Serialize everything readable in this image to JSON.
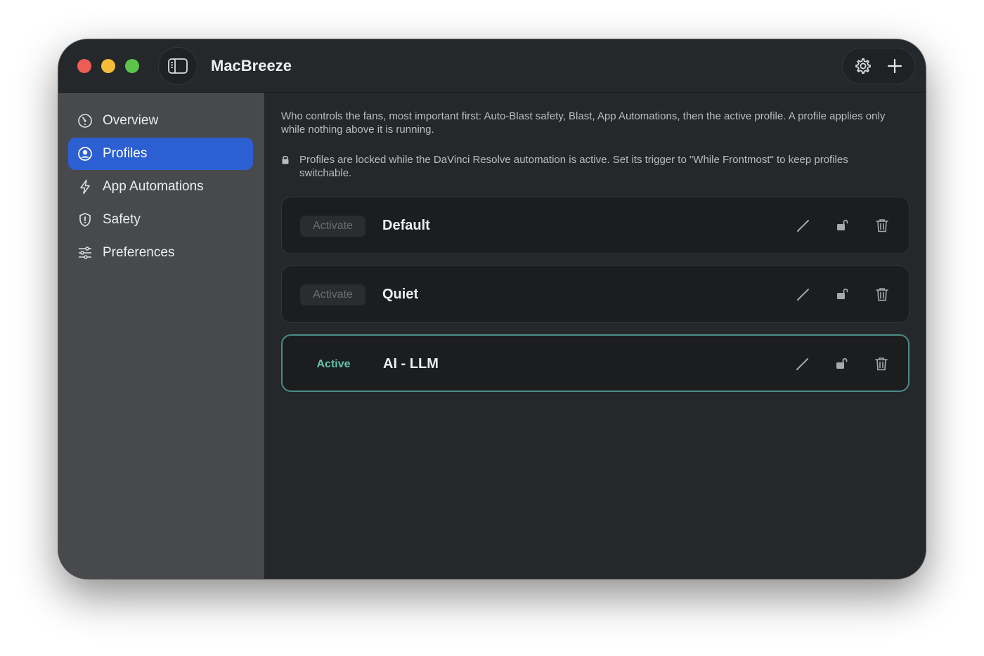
{
  "window": {
    "app_title": "MacBreeze"
  },
  "colors": {
    "accent": "#2c5fd1",
    "active_text": "#63c2b0",
    "active_border": "#4a8c86",
    "close": "#ee5c56",
    "minimize": "#f4bd39",
    "maximize": "#5cc448"
  },
  "toolbar": {
    "settings_icon": "gear-icon",
    "add_icon": "plus-icon",
    "sidebar_toggle_icon": "sidebar-icon"
  },
  "sidebar": {
    "items": [
      {
        "label": "Overview",
        "icon": "gauge-icon",
        "selected": false
      },
      {
        "label": "Profiles",
        "icon": "person-circle-icon",
        "selected": true
      },
      {
        "label": "App Automations",
        "icon": "bolt-icon",
        "selected": false
      },
      {
        "label": "Safety",
        "icon": "shield-icon",
        "selected": false
      },
      {
        "label": "Preferences",
        "icon": "sliders-icon",
        "selected": false
      }
    ]
  },
  "main": {
    "description": "Who controls the fans, most important first: Auto-Blast safety, Blast, App Automations, then the active profile. A profile applies only while nothing above it is running.",
    "lock_note": "Profiles are locked while the DaVinci Resolve automation is active. Set its trigger to \"While Frontmost\" to keep profiles switchable.",
    "profiles": [
      {
        "name": "Default",
        "state_label": "Activate",
        "active": false
      },
      {
        "name": "Quiet",
        "state_label": "Activate",
        "active": false
      },
      {
        "name": "AI - LLM",
        "state_label": "Active",
        "active": true
      }
    ]
  }
}
